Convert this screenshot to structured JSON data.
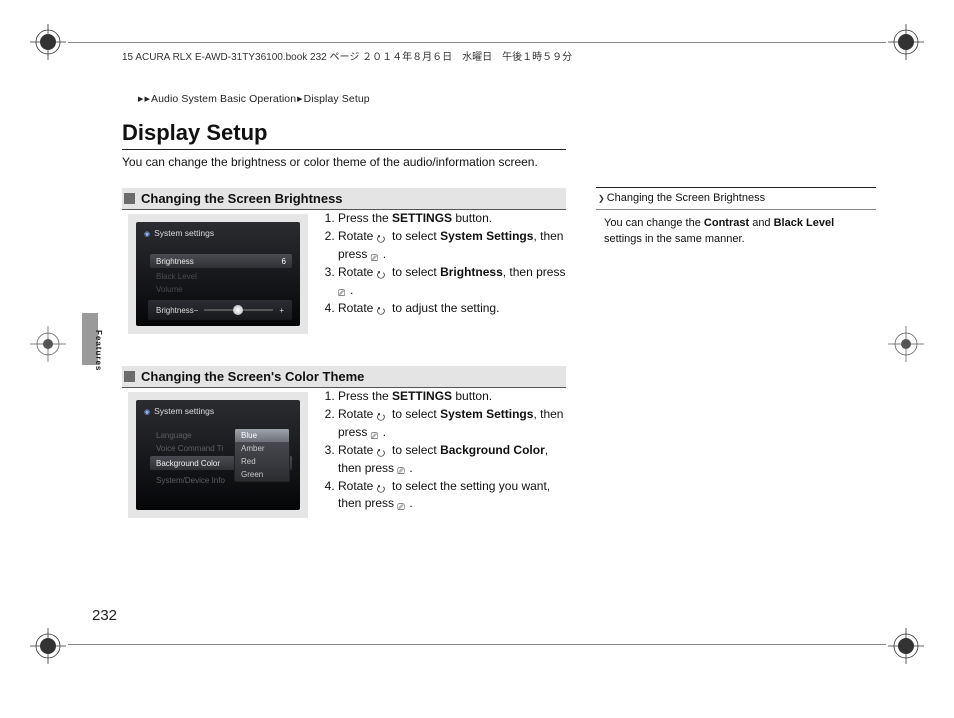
{
  "header_text": "15 ACURA RLX E-AWD-31TY36100.book  232 ページ  ２０１４年８月６日　水曜日　午後１時５９分",
  "breadcrumb": {
    "item1": "Audio System Basic Operation",
    "item2": "Display Setup"
  },
  "title": "Display Setup",
  "intro": "You can change the brightness or color theme of the audio/information screen.",
  "section1": {
    "heading": "Changing the Screen Brightness",
    "screen": {
      "title": "System settings",
      "row_brightness": "Brightness",
      "row_brightness_val": "6",
      "row_dim1": "Black Level",
      "row_dim2": "Volume",
      "slider_label": "Brightness",
      "slider_minus": "−",
      "slider_plus": "+"
    },
    "steps": [
      {
        "pre": "Press the ",
        "bold": "SETTINGS",
        "post": " button."
      },
      {
        "pre": "Rotate ",
        "icon": "ring",
        "mid": " to select ",
        "bold": "System Settings",
        "post2": ", then press ",
        "icon2": "push",
        "tail": "."
      },
      {
        "pre": "Rotate ",
        "icon": "ring",
        "mid": " to select ",
        "bold": "Brightness",
        "post2": ", then press ",
        "icon2": "push",
        "tail": "."
      },
      {
        "pre": "Rotate ",
        "icon": "ring",
        "mid": " to adjust the setting.",
        "bold": "",
        "post2": "",
        "icon2": "",
        "tail": ""
      }
    ]
  },
  "section2": {
    "heading": "Changing the Screen's Color Theme",
    "screen": {
      "title": "System settings",
      "row_g1": "Language",
      "row_g2": "Voice Command Ti",
      "row_bg": "Background Color",
      "row_g3": "System/Device Info",
      "menu": [
        "Blue",
        "Amber",
        "Red",
        "Green"
      ]
    },
    "steps": [
      {
        "pre": "Press the ",
        "bold": "SETTINGS",
        "post": " button."
      },
      {
        "pre": "Rotate ",
        "icon": "ring",
        "mid": " to select ",
        "bold": "System Settings",
        "post2": ", then press ",
        "icon2": "push",
        "tail": "."
      },
      {
        "pre": "Rotate ",
        "icon": "ring",
        "mid": " to select ",
        "bold": "Background Color",
        "post2": ", then press ",
        "icon2": "push",
        "tail": "."
      },
      {
        "pre": "Rotate ",
        "icon": "ring",
        "mid": " to select the setting you want, then press ",
        "bold": "",
        "post2": "",
        "icon2": "push",
        "tail": "."
      }
    ]
  },
  "sidebar": {
    "heading": "Changing the Screen Brightness",
    "body_pre": "You can change the ",
    "body_b1": "Contrast",
    "body_mid": " and ",
    "body_b2": "Black Level",
    "body_post": " settings in the same manner."
  },
  "features_label": "Features",
  "page_number": "232"
}
